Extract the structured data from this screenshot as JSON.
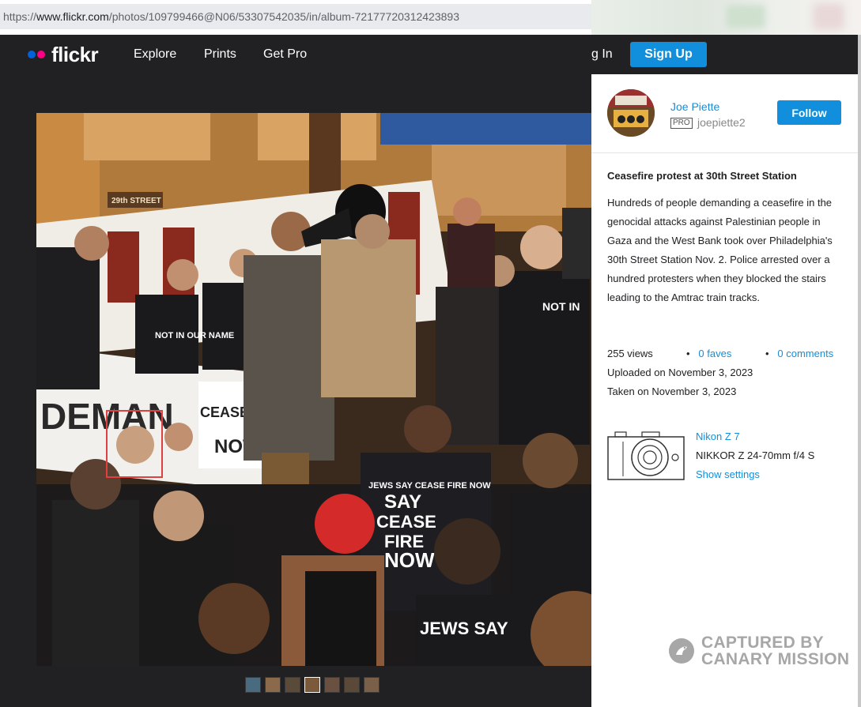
{
  "browser": {
    "url_prefix": "https://",
    "url_host": "www.flickr.com",
    "url_path": "/photos/109799466@N06/53307542035/in/album-72177720312423893"
  },
  "nav": {
    "logo_text": "flickr",
    "links": [
      "Explore",
      "Prints",
      "Get Pro"
    ],
    "login_label": "g In",
    "signup_label": "Sign Up"
  },
  "photo": {
    "banner_text_1": "NOT IN OUR NAME",
    "banner_text_2": "DEMAN",
    "sign_text_1": "CEASEFIRE",
    "sign_text_2": "NOW",
    "shirt_text_1": "JEWS SAY CEASE FIRE NOW",
    "shirt_text_2": "JEWS SAY",
    "station_sign": "29th STREET"
  },
  "owner": {
    "name": "Joe Piette",
    "pro_badge": "PRO",
    "handle": "joepiette2",
    "follow_label": "Follow"
  },
  "details": {
    "title": "Ceasefire protest at 30th Street Station",
    "description": "Hundreds of people demanding a ceasefire in the genocidal attacks against Palestinian people in Gaza and the West Bank took over Philadelphia's 30th Street Station Nov. 2. Police arrested over a hundred protesters when they blocked the stairs leading to the Amtrac train tracks.",
    "views": "255 views",
    "faves": "0 faves",
    "comments": "0 comments",
    "uploaded": "Uploaded on November 3, 2023",
    "taken": "Taken on November 3, 2023"
  },
  "camera": {
    "model": "Nikon Z 7",
    "lens": "NIKKOR Z 24-70mm f/4 S",
    "settings_label": "Show settings"
  },
  "watermark": {
    "line1": "CAPTURED BY",
    "line2": "CANARY MISSION"
  },
  "colors": {
    "brand_blue": "#128fdc",
    "nav_bg": "#212124",
    "highlight_box": "#e04040"
  }
}
